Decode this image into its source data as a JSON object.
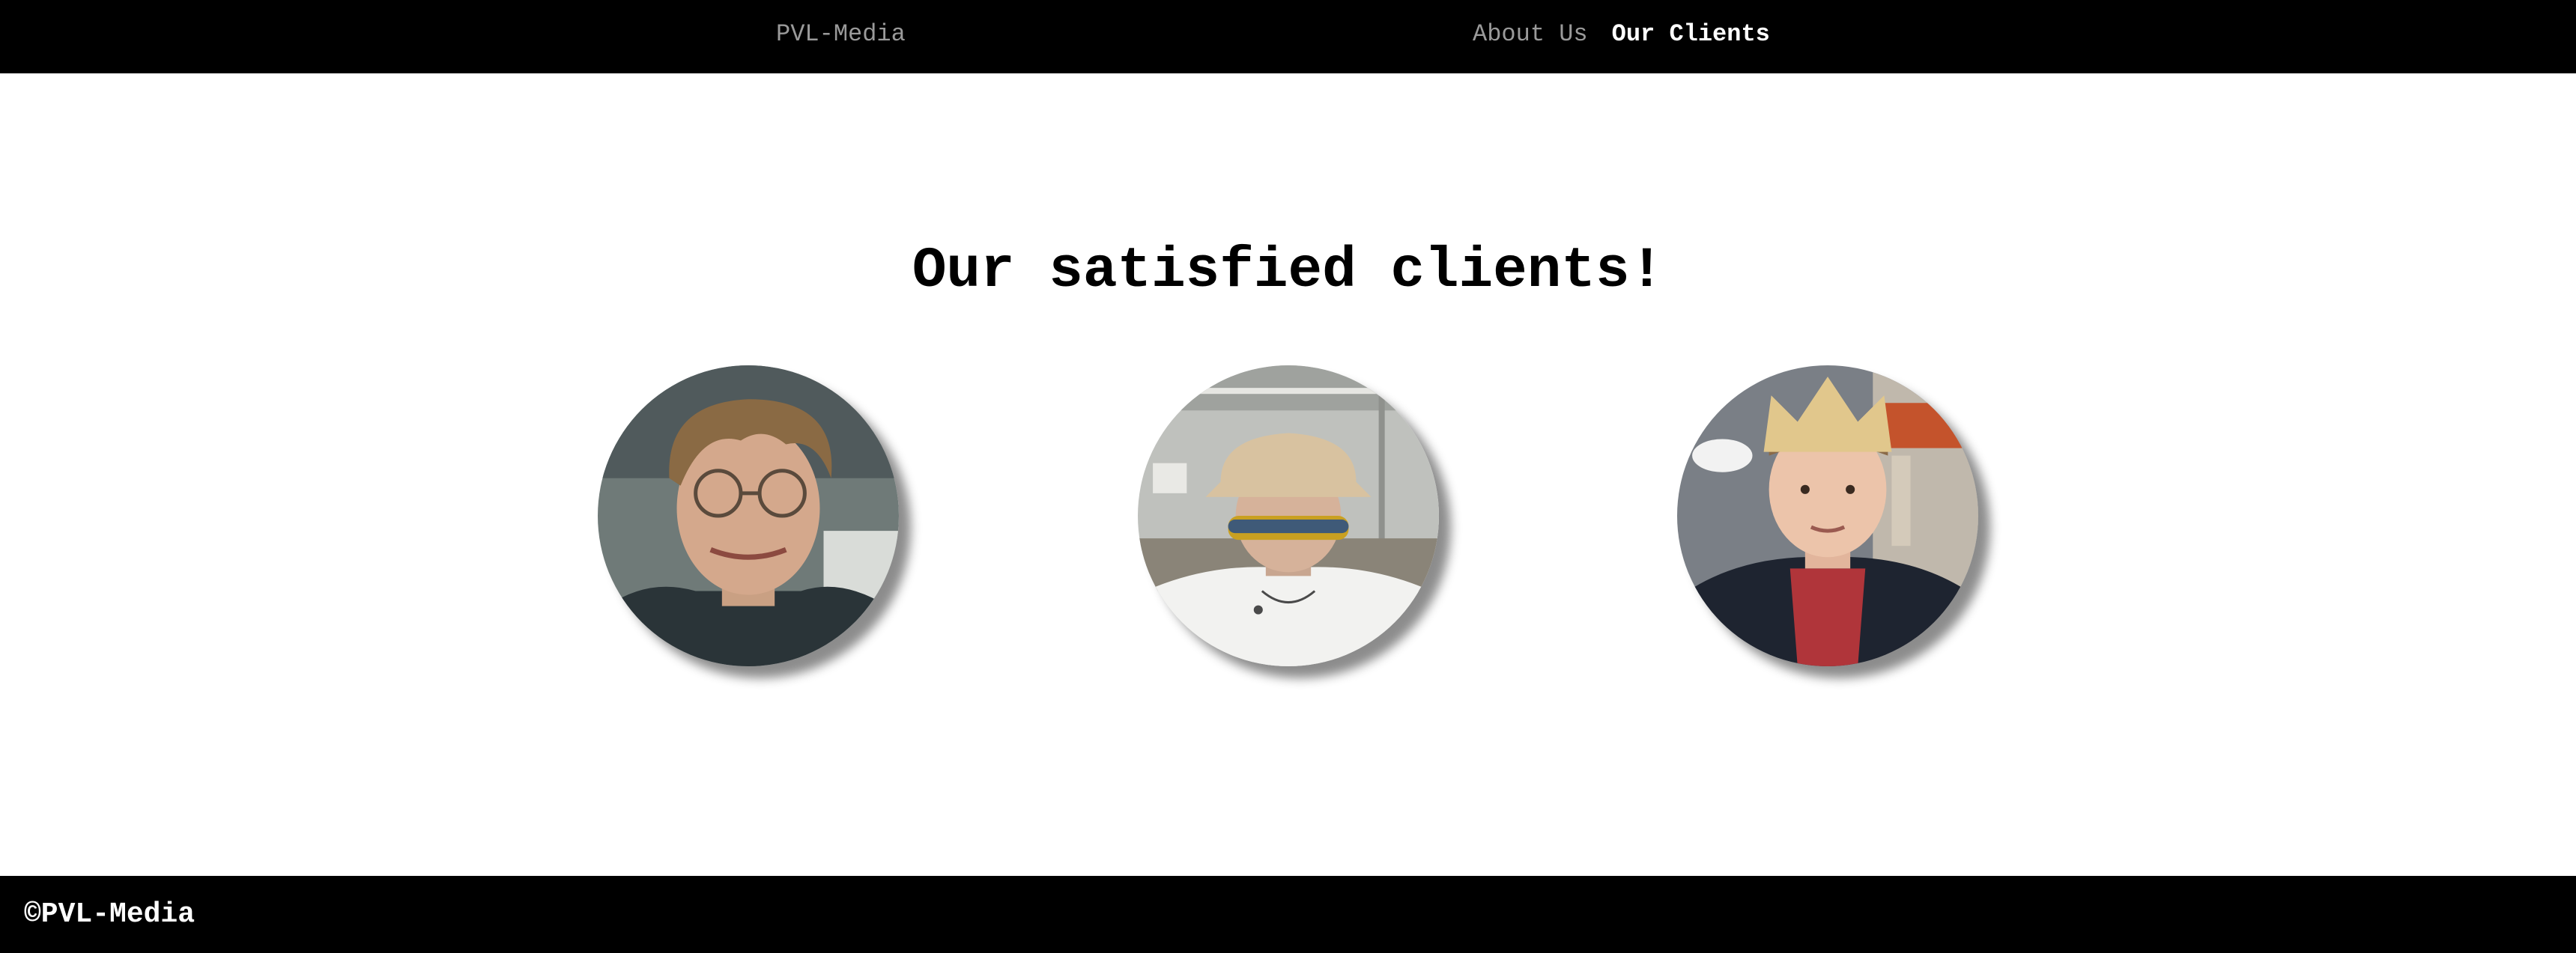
{
  "nav": {
    "brand": "PVL-Media",
    "links": [
      {
        "label": "About Us",
        "active": false
      },
      {
        "label": "Our Clients",
        "active": true
      }
    ]
  },
  "main": {
    "title": "Our satisfied clients!",
    "clients": [
      {
        "photo": "client-photo-1"
      },
      {
        "photo": "client-photo-2"
      },
      {
        "photo": "client-photo-3"
      }
    ]
  },
  "footer": {
    "text": "©PVL-Media"
  },
  "colors": {
    "nav_bg": "#000000",
    "nav_link": "#9a9a9a",
    "nav_active": "#ffffff",
    "page_bg": "#ffffff",
    "footer_bg": "#000000"
  }
}
